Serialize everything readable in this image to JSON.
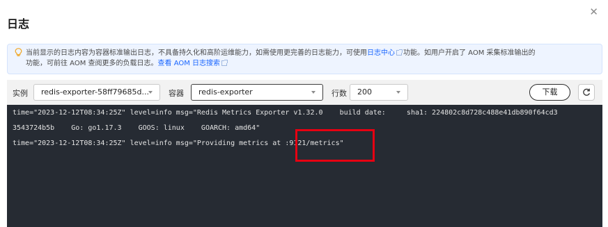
{
  "dialog": {
    "title": "日志"
  },
  "notice": {
    "text_1": "当前显示的日志内容为容器标准输出日志，不具备持久化和高阶运维能力，如需使用更完善的日志能力，可使用",
    "link_1": "日志中心",
    "text_2": "功能。如用户开启了 AOM 采集标准输出的",
    "text_3": "功能，可前往 AOM 查阅更多的负载日志。",
    "link_2": "查看 AOM 日志搜索"
  },
  "toolbar": {
    "instance_label": "实例",
    "instance_value": "redis-exporter-58ff79685d...",
    "container_label": "容器",
    "container_value": "redis-exporter",
    "lines_label": "行数",
    "lines_value": "200",
    "download_label": "下载"
  },
  "log_lines": [
    "time=\"2023-12-12T08:34:25Z\" level=info msg=\"Redis Metrics Exporter v1.32.0    build date:     sha1: 224802c8d728c488e41db890f64cd3",
    "3543724b5b    Go: go1.17.3    GOOS: linux    GOARCH: amd64\"",
    "time=\"2023-12-12T08:34:25Z\" level=info msg=\"Providing metrics at :9121/metrics\""
  ],
  "colors": {
    "accent": "#1a66ff",
    "console_bg": "#262b33",
    "highlight": "#e60012",
    "notice_bg": "#eef4ff"
  }
}
